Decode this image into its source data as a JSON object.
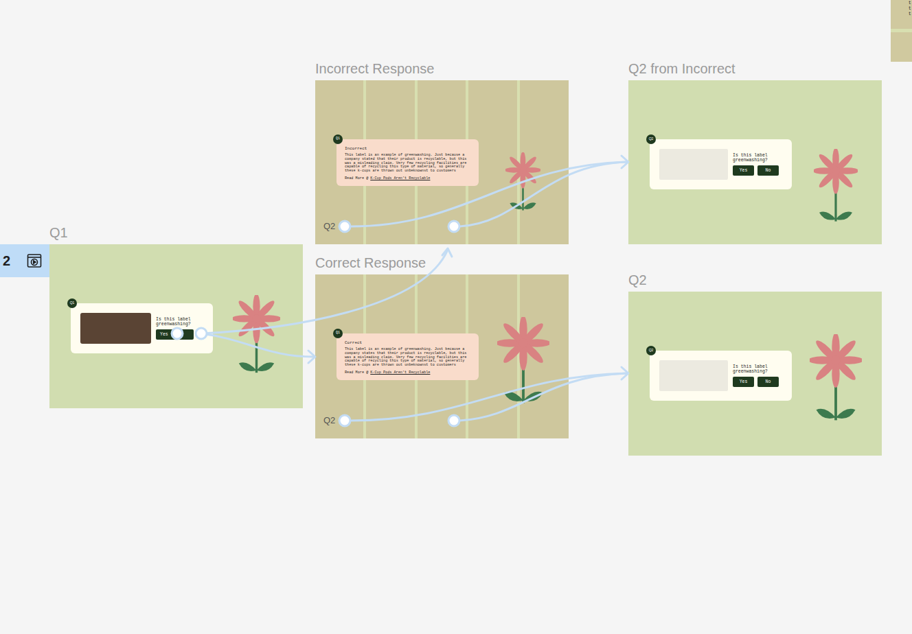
{
  "flow_starting_point": {
    "label": "2"
  },
  "edge_note": {
    "lines": [
      "t",
      "t",
      "t"
    ]
  },
  "frames": [
    {
      "label": "Q1",
      "kind": "question",
      "badge": "Q1",
      "question": "Is this label greenwashing?",
      "buttons": [
        "Yes"
      ]
    },
    {
      "label": "Incorrect Response",
      "kind": "response",
      "badge": "Q1",
      "heading": "Incorrect",
      "body": "This label is an example of greenwashing. Just because a company stated that their product is recyclable, but this was a misleading claim. Very few recycling facilities are capable of recycling this type of material, so generally these k-cups are thrown out unbeknownst to customers",
      "link_prefix": "Read More @",
      "link": "K-Cup Pods Aren't Recyclable",
      "footer": "Q2"
    },
    {
      "label": "Correct Response",
      "kind": "response",
      "badge": "Q1",
      "heading": "Correct",
      "body": "This label is an example of greenwashing. Just because a company states that their product is recyclable, but this was a misleading claim. Very few recycling facilities are capable of recycling this type of material, so generally these k-cups are thrown out unbeknownst to customers",
      "link_prefix": "Read More @",
      "link": "K-Cup Pods Aren't Recyclable",
      "footer": "Q2"
    },
    {
      "label": "Q2 from Incorrect",
      "kind": "question",
      "badge": "Q2",
      "question": "Is this label greenwashing?",
      "buttons": [
        "Yes",
        "No"
      ]
    },
    {
      "label": "Q2",
      "kind": "question",
      "badge": "Q2",
      "question": "Is this label greenwashing?",
      "buttons": [
        "Yes",
        "No"
      ]
    }
  ]
}
